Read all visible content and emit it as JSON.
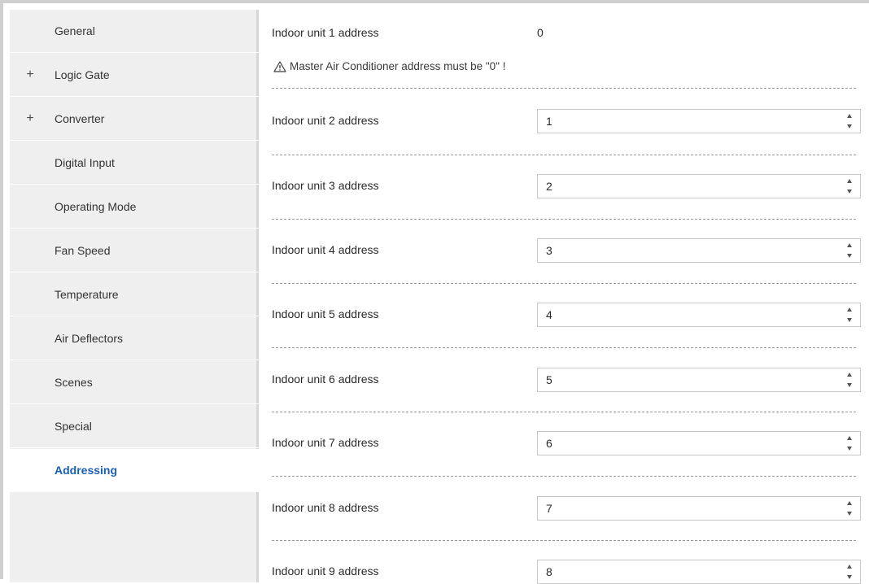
{
  "sidebar": {
    "items": [
      {
        "label": "General",
        "expandable": false,
        "active": false
      },
      {
        "label": "Logic Gate",
        "expandable": true,
        "active": false
      },
      {
        "label": "Converter",
        "expandable": true,
        "active": false
      },
      {
        "label": "Digital Input",
        "expandable": false,
        "active": false
      },
      {
        "label": "Operating Mode",
        "expandable": false,
        "active": false
      },
      {
        "label": "Fan Speed",
        "expandable": false,
        "active": false
      },
      {
        "label": "Temperature",
        "expandable": false,
        "active": false
      },
      {
        "label": "Air Deflectors",
        "expandable": false,
        "active": false
      },
      {
        "label": "Scenes",
        "expandable": false,
        "active": false
      },
      {
        "label": "Special",
        "expandable": false,
        "active": false
      },
      {
        "label": "Addressing",
        "expandable": false,
        "active": true
      }
    ],
    "expand_symbol": "+"
  },
  "main": {
    "unit1": {
      "label": "Indoor unit 1 address",
      "value": "0"
    },
    "warning": {
      "icon": "warning-triangle-icon",
      "text": "Master Air Conditioner address must be \"0\" !"
    },
    "units": [
      {
        "label": "Indoor unit 2 address",
        "value": "1"
      },
      {
        "label": "Indoor unit 3 address",
        "value": "2"
      },
      {
        "label": "Indoor unit 4 address",
        "value": "3"
      },
      {
        "label": "Indoor unit 5 address",
        "value": "4"
      },
      {
        "label": "Indoor unit 6 address",
        "value": "5"
      },
      {
        "label": "Indoor unit 7 address",
        "value": "6"
      },
      {
        "label": "Indoor unit 8 address",
        "value": "7"
      },
      {
        "label": "Indoor unit 9 address",
        "value": "8"
      }
    ]
  },
  "colors": {
    "active_nav_text": "#1a5fb4",
    "sidebar_bg": "#efefef"
  }
}
